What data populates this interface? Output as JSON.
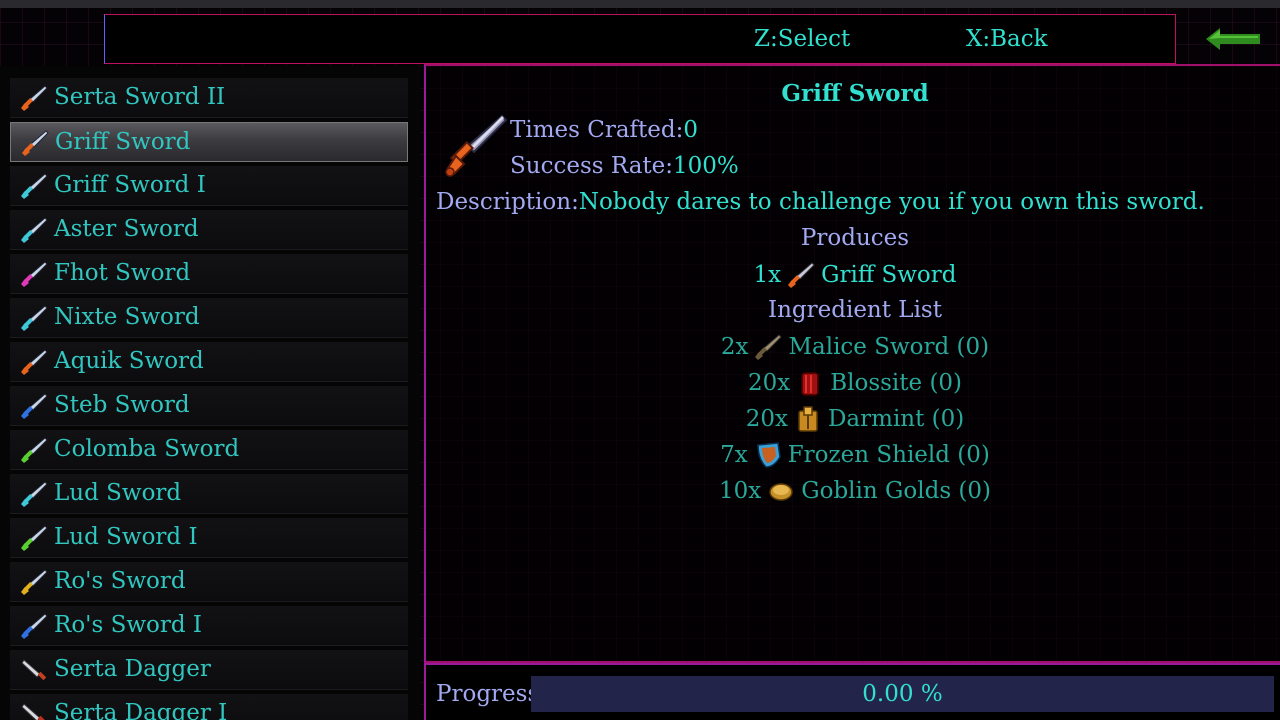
{
  "header": {
    "select_hint": "Z:Select",
    "back_hint": "X:Back",
    "back_icon": "green-left-arrow-icon"
  },
  "recipe_list": {
    "items": [
      {
        "label": "Serta Sword II",
        "icon": "sword-icon",
        "color": "#e8641e"
      },
      {
        "label": "Griff Sword",
        "icon": "sword-icon",
        "color": "#e8641e",
        "selected": true
      },
      {
        "label": "Griff Sword I",
        "icon": "sword-icon",
        "color": "#3fc8d8"
      },
      {
        "label": "Aster Sword",
        "icon": "sword-icon",
        "color": "#3fc8d8"
      },
      {
        "label": "Fhot Sword",
        "icon": "sword-icon",
        "color": "#e03ab8"
      },
      {
        "label": "Nixte Sword",
        "icon": "sword-icon",
        "color": "#3fc8d8"
      },
      {
        "label": "Aquik Sword",
        "icon": "sword-icon",
        "color": "#e8641e"
      },
      {
        "label": "Steb Sword",
        "icon": "sword-icon",
        "color": "#3070e0"
      },
      {
        "label": "Colomba Sword",
        "icon": "sword-icon",
        "color": "#5ad030"
      },
      {
        "label": "Lud Sword",
        "icon": "sword-icon",
        "color": "#3fc8d8"
      },
      {
        "label": "Lud Sword I",
        "icon": "sword-icon",
        "color": "#5ad030"
      },
      {
        "label": "Ro's Sword",
        "icon": "sword-icon",
        "color": "#e0b020"
      },
      {
        "label": "Ro's Sword I",
        "icon": "sword-icon",
        "color": "#3070e0"
      },
      {
        "label": "Serta Dagger",
        "icon": "dagger-icon",
        "color": "#c04020"
      },
      {
        "label": "Serta Dagger I",
        "icon": "dagger-icon",
        "color": "#c03020"
      }
    ]
  },
  "detail": {
    "title": "Griff Sword",
    "icon": "griff-sword-icon",
    "times_crafted_label": "Times Crafted:",
    "times_crafted_value": "0",
    "success_rate_label": "Success Rate:",
    "success_rate_value": "100%",
    "description_label": "Description:",
    "description_value": "Nobody dares to challenge you if you own this sword.",
    "produces_heading": "Produces",
    "produces": {
      "qty": "1x",
      "name": "Griff Sword",
      "icon": "sword-icon"
    },
    "ingredients_heading": "Ingredient List",
    "ingredients": [
      {
        "qty": "2x",
        "name": "Malice Sword (0)",
        "icon": "malice-sword-icon"
      },
      {
        "qty": "20x",
        "name": "Blossite (0)",
        "icon": "blossite-icon"
      },
      {
        "qty": "20x",
        "name": "Darmint (0)",
        "icon": "darmint-icon"
      },
      {
        "qty": "7x",
        "name": "Frozen Shield (0)",
        "icon": "shield-icon"
      },
      {
        "qty": "10x",
        "name": "Goblin Golds (0)",
        "icon": "gold-coin-icon"
      }
    ]
  },
  "progress": {
    "label": "Progress:",
    "value_text": "0.00 %",
    "fraction": 0
  }
}
